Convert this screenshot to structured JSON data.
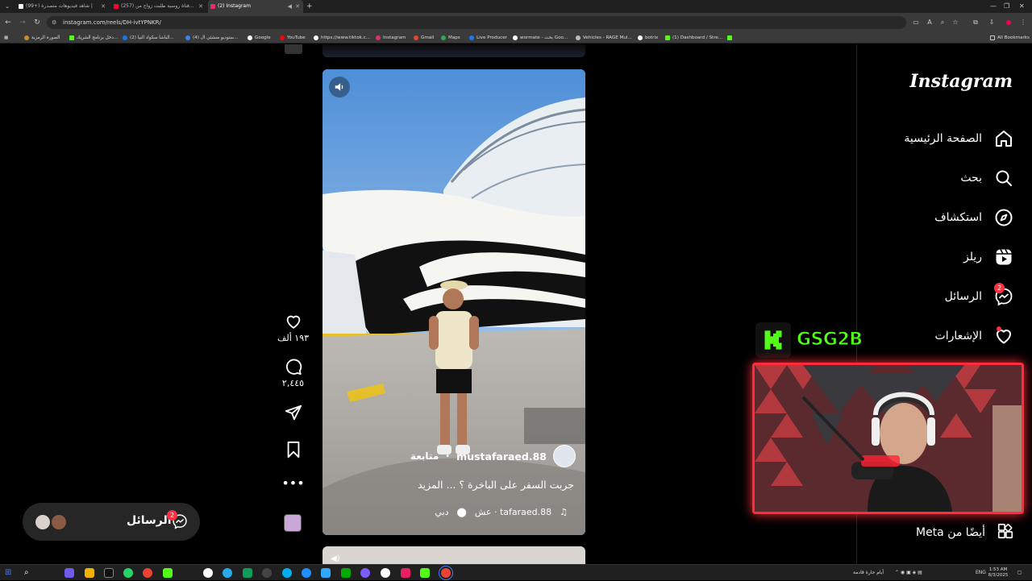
{
  "browser": {
    "tabs": [
      {
        "title": "(99+) شاهد فيديوهات متصدرة |",
        "color": "#ffffff"
      },
      {
        "title": "(257) فتاة روسية طلبت زواج من...",
        "color": "#ff0033"
      },
      {
        "title": "(2) Instagram",
        "color": "#e1306c"
      }
    ],
    "url": "instagram.com/reels/DH-ivtYPNKR/",
    "bookmarks": [
      {
        "label": "الصورة الرمزية",
        "color": "#d08a2c"
      },
      {
        "label": "دخل برنامج الشريك...",
        "color": "#53fc18"
      },
      {
        "label": "(2) الباشا سكواد البيا...",
        "color": "#1877f2"
      },
      {
        "label": "(4) ستوديو منشئي ال...",
        "color": "#3b82f6"
      },
      {
        "label": "Google",
        "color": "#ffffff"
      },
      {
        "label": "YouTube",
        "color": "#ff0000"
      },
      {
        "label": "https://www.tiktok.c...",
        "color": "#ffffff"
      },
      {
        "label": "Instagram",
        "color": "#e1306c"
      },
      {
        "label": "Gmail",
        "color": "#ea4335"
      },
      {
        "label": "Maps",
        "color": "#34a853"
      },
      {
        "label": "Live Producer",
        "color": "#1877f2"
      },
      {
        "label": "wormate - بحث Goo...",
        "color": "#ffffff"
      },
      {
        "label": "Vehicles - RAGE Mul...",
        "color": "#bbbbbb"
      },
      {
        "label": "botrix",
        "color": "#ffffff"
      },
      {
        "label": "(1) Dashboard / Stre...",
        "color": "#53fc18"
      }
    ],
    "all_bookmarks": "All Bookmarks"
  },
  "instagram": {
    "logo": "Instagram",
    "nav": [
      {
        "label": "الصفحة الرئيسية",
        "icon": "home-icon"
      },
      {
        "label": "بحث",
        "icon": "search-icon"
      },
      {
        "label": "استكشاف",
        "icon": "explore-icon"
      },
      {
        "label": "ريلز",
        "icon": "reels-icon"
      },
      {
        "label": "الرسائل",
        "icon": "messenger-icon",
        "badge": "2"
      },
      {
        "label": "الإشعارات",
        "icon": "heart-icon",
        "dot": true
      }
    ],
    "more_label": "أيضًا من Meta",
    "reel": {
      "author": "mustafaraed.88",
      "follow": "متابعة",
      "caption": "جربت السفر على الباخرة ؟ ... المزيد",
      "audio": "tafaraed.88 · عش",
      "location": "دبي",
      "likes": "١٩٣ ألف",
      "comments": "٢,٤٤٥"
    },
    "messages": {
      "label": "الرسائل",
      "badge": "2"
    }
  },
  "overlay": {
    "kick_name": "GSG2B"
  },
  "taskbar": {
    "tray_text": "أيام حارة قادمة",
    "lang": "ENG",
    "time": "1:53 AM",
    "date": "8/3/2025"
  },
  "colors": {
    "accent_red": "#ff3040",
    "kick_green": "#53fc18"
  }
}
